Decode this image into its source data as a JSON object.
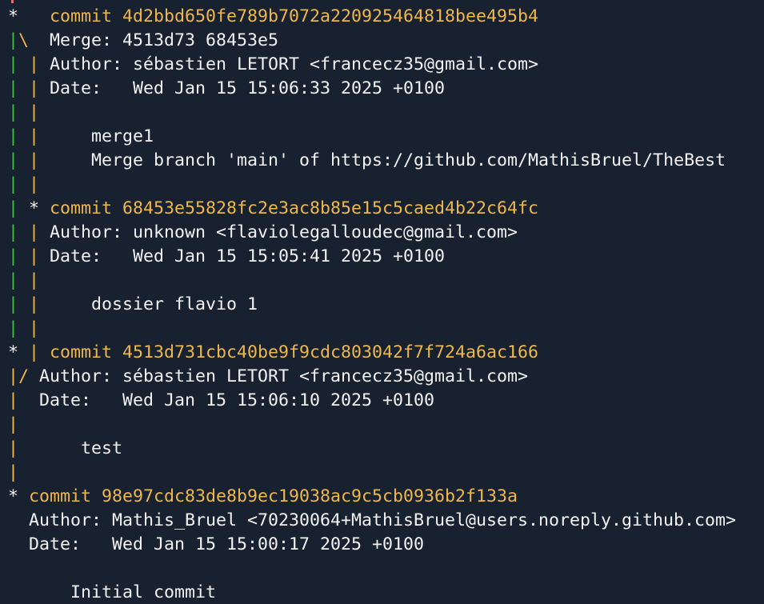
{
  "terminal": {
    "lines": [
      [
        [
          "*   ",
          "text"
        ],
        [
          "commit 4d2bbd650fe789b7072a220925464818bee495b4",
          "hash"
        ]
      ],
      [
        [
          "|",
          "green"
        ],
        [
          "\\  ",
          "yellow"
        ],
        [
          "Merge: 4513d73 68453e5",
          "text"
        ]
      ],
      [
        [
          "| ",
          "green"
        ],
        [
          "| ",
          "yellow"
        ],
        [
          "Author: sébastien LETORT <francecz35@gmail.com>",
          "text"
        ]
      ],
      [
        [
          "| ",
          "green"
        ],
        [
          "| ",
          "yellow"
        ],
        [
          "Date:   Wed Jan 15 15:06:33 2025 +0100",
          "text"
        ]
      ],
      [
        [
          "| ",
          "green"
        ],
        [
          "|",
          "yellow"
        ]
      ],
      [
        [
          "| ",
          "green"
        ],
        [
          "| ",
          "yellow"
        ],
        [
          "    merge1",
          "text"
        ]
      ],
      [
        [
          "| ",
          "green"
        ],
        [
          "| ",
          "yellow"
        ],
        [
          "    Merge branch 'main' of https://github.com/MathisBruel/TheBest",
          "text"
        ]
      ],
      [
        [
          "| ",
          "green"
        ],
        [
          "|",
          "yellow"
        ]
      ],
      [
        [
          "| ",
          "green"
        ],
        [
          "* ",
          "text"
        ],
        [
          "commit 68453e55828fc2e3ac8b85e15c5caed4b22c64fc",
          "hash"
        ]
      ],
      [
        [
          "| ",
          "green"
        ],
        [
          "| ",
          "yellow"
        ],
        [
          "Author: unknown <flaviolegalloudec@gmail.com>",
          "text"
        ]
      ],
      [
        [
          "| ",
          "green"
        ],
        [
          "| ",
          "yellow"
        ],
        [
          "Date:   Wed Jan 15 15:05:41 2025 +0100",
          "text"
        ]
      ],
      [
        [
          "| ",
          "green"
        ],
        [
          "|",
          "yellow"
        ]
      ],
      [
        [
          "| ",
          "green"
        ],
        [
          "| ",
          "yellow"
        ],
        [
          "    dossier flavio 1",
          "text"
        ]
      ],
      [
        [
          "| ",
          "green"
        ],
        [
          "|",
          "yellow"
        ]
      ],
      [
        [
          "* ",
          "text"
        ],
        [
          "| ",
          "yellow"
        ],
        [
          "commit 4513d731cbc40be9f9cdc803042f7f724a6ac166",
          "hash"
        ]
      ],
      [
        [
          "|/ ",
          "yellow"
        ],
        [
          "Author: sébastien LETORT <francecz35@gmail.com>",
          "text"
        ]
      ],
      [
        [
          "|  ",
          "yellow"
        ],
        [
          "Date:   Wed Jan 15 15:06:10 2025 +0100",
          "text"
        ]
      ],
      [
        [
          "|",
          "yellow"
        ]
      ],
      [
        [
          "|  ",
          "yellow"
        ],
        [
          "    test",
          "text"
        ]
      ],
      [
        [
          "|",
          "yellow"
        ]
      ],
      [
        [
          "* ",
          "text"
        ],
        [
          "commit 98e97cdc83de8b9ec19038ac9c5cb0936b2f133a",
          "hash"
        ]
      ],
      [
        [
          "  Author: Mathis_Bruel <70230064+MathisBruel@users.noreply.github.com>",
          "text"
        ]
      ],
      [
        [
          "  Date:   Wed Jan 15 15:00:17 2025 +0100",
          "text"
        ]
      ],
      [],
      [
        [
          "      Initial commit",
          "text"
        ]
      ]
    ]
  },
  "colors": {
    "background": "#172130",
    "text": "#f2f2f2",
    "hash": "#f0b74a",
    "graph_green": "#3fbf3f",
    "graph_yellow": "#f0b74a",
    "graph_red": "#e06c75"
  }
}
